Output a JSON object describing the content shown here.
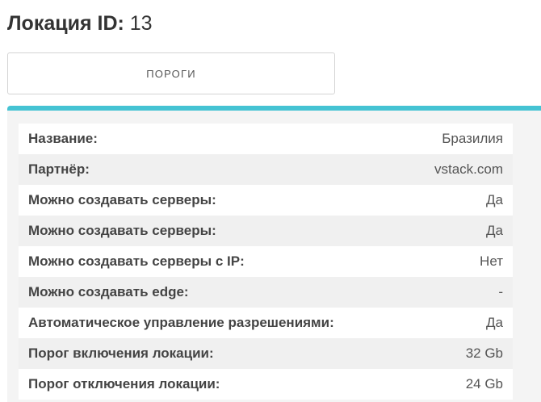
{
  "header": {
    "label": "Локация ID:",
    "value": "13"
  },
  "tabs": {
    "thresholds_label": "ПОРОГИ"
  },
  "colors": {
    "accent": "#45c3d3"
  },
  "details": [
    {
      "key": "Название:",
      "value": "Бразилия"
    },
    {
      "key": "Партнёр:",
      "value": "vstack.com"
    },
    {
      "key": "Можно создавать серверы:",
      "value": "Да"
    },
    {
      "key": "Можно создавать серверы:",
      "value": "Да"
    },
    {
      "key": "Можно создавать серверы с IP:",
      "value": "Нет"
    },
    {
      "key": "Можно создавать edge:",
      "value": "-"
    },
    {
      "key": "Автоматическое управление разрешениями:",
      "value": "Да"
    },
    {
      "key": "Порог включения локации:",
      "value": "32 Gb"
    },
    {
      "key": "Порог отключения локации:",
      "value": "24 Gb"
    }
  ]
}
